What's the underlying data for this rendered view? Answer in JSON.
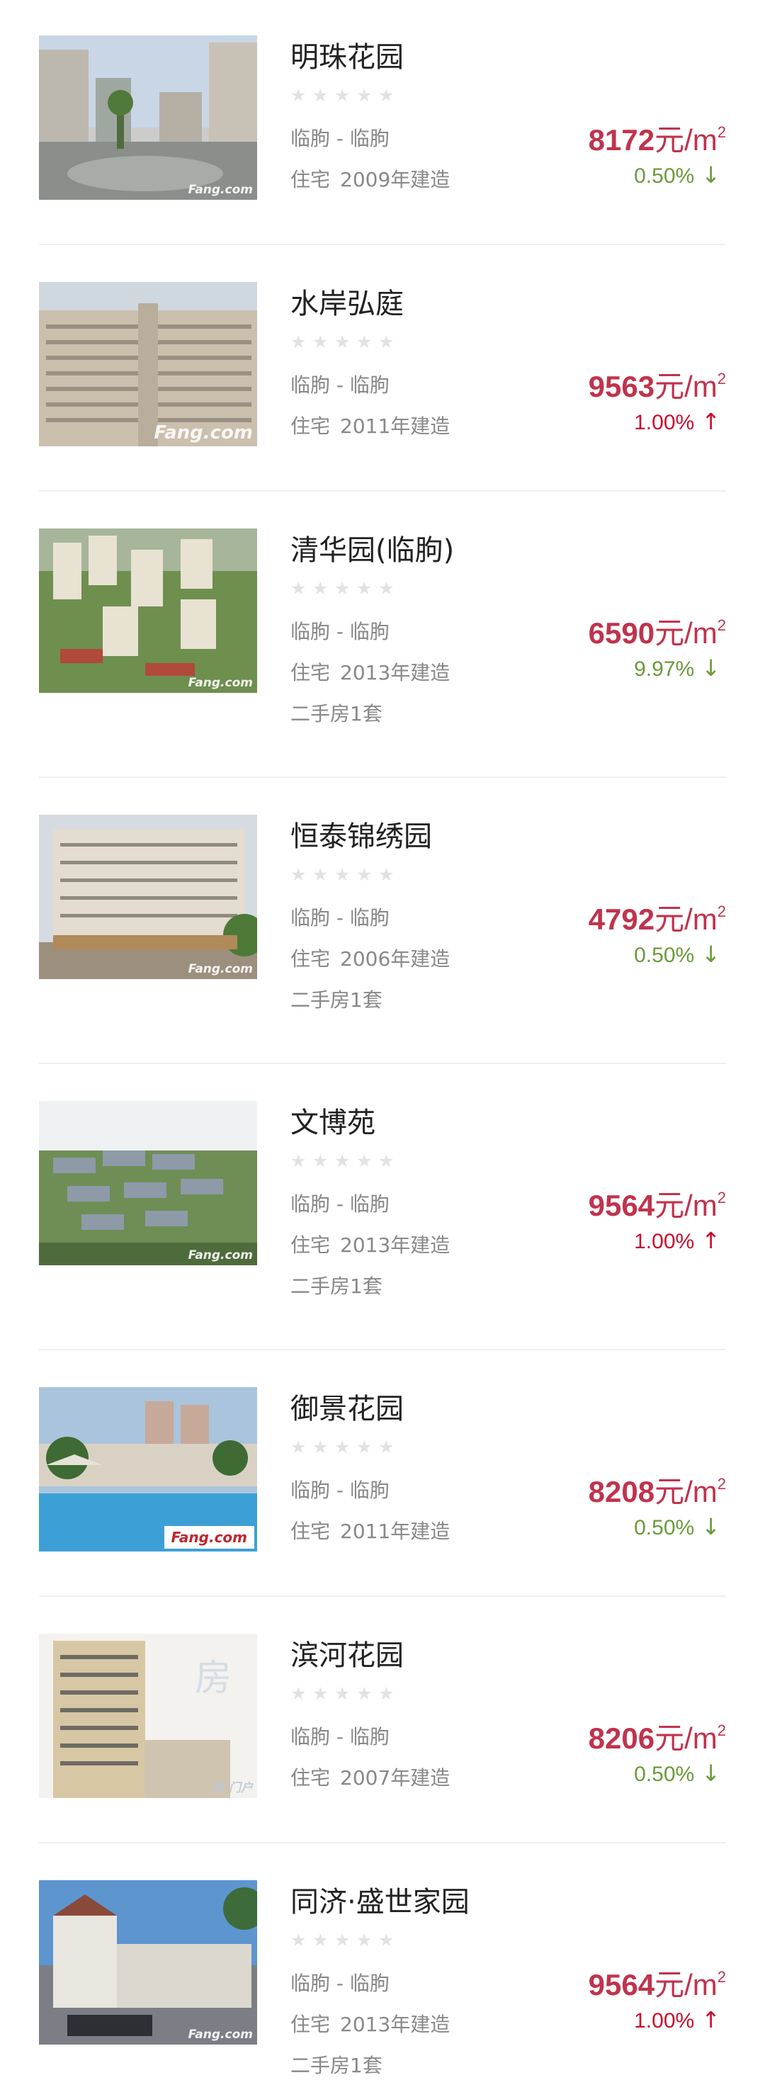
{
  "listings": [
    {
      "name": "明珠花园",
      "district": "临朐 - 临朐",
      "type": "住宅",
      "built": "2009年建造",
      "second_hand": "",
      "price_num": "8172",
      "price_unit": "元/m",
      "price_sup": "2",
      "change": "0.50%",
      "trend": "down",
      "watermark": "Fang.com",
      "image": "building-courtyard"
    },
    {
      "name": "水岸弘庭",
      "district": "临朐 - 临朐",
      "type": "住宅",
      "built": "2011年建造",
      "second_hand": "",
      "price_num": "9563",
      "price_unit": "元/m",
      "price_sup": "2",
      "change": "1.00%",
      "trend": "up",
      "watermark": "Fang.com",
      "image": "tower-facade"
    },
    {
      "name": "清华园(临朐)",
      "district": "临朐 - 临朐",
      "type": "住宅",
      "built": "2013年建造",
      "second_hand": "二手房1套",
      "price_num": "6590",
      "price_unit": "元/m",
      "price_sup": "2",
      "change": "9.97%",
      "trend": "down",
      "watermark": "Fang.com",
      "image": "aerial-render"
    },
    {
      "name": "恒泰锦绣园",
      "district": "临朐 - 临朐",
      "type": "住宅",
      "built": "2006年建造",
      "second_hand": "二手房1套",
      "price_num": "4792",
      "price_unit": "元/m",
      "price_sup": "2",
      "change": "0.50%",
      "trend": "down",
      "watermark": "Fang.com",
      "image": "street-building"
    },
    {
      "name": "文博苑",
      "district": "临朐 - 临朐",
      "type": "住宅",
      "built": "2013年建造",
      "second_hand": "二手房1套",
      "price_num": "9564",
      "price_unit": "元/m",
      "price_sup": "2",
      "change": "1.00%",
      "trend": "up",
      "watermark": "Fang.com",
      "image": "aerial-rows"
    },
    {
      "name": "御景花园",
      "district": "临朐 - 临朐",
      "type": "住宅",
      "built": "2011年建造",
      "second_hand": "",
      "price_num": "8208",
      "price_unit": "元/m",
      "price_sup": "2",
      "change": "0.50%",
      "trend": "down",
      "watermark": "Fang.com",
      "image": "pool-view"
    },
    {
      "name": "滨河花园",
      "district": "临朐 - 临朐",
      "type": "住宅",
      "built": "2007年建造",
      "second_hand": "",
      "price_num": "8206",
      "price_unit": "元/m",
      "price_sup": "2",
      "change": "0.50%",
      "trend": "down",
      "watermark": "房 门户",
      "image": "beige-tower"
    },
    {
      "name": "同济·盛世家园",
      "district": "临朐 - 临朐",
      "type": "住宅",
      "built": "2013年建造",
      "second_hand": "二手房1套",
      "price_num": "9564",
      "price_unit": "元/m",
      "price_sup": "2",
      "change": "1.00%",
      "trend": "up",
      "watermark": "Fang.com",
      "image": "clubhouse-render"
    }
  ],
  "colors": {
    "price": "#c0334d",
    "up": "#c8102e",
    "down": "#6b9a3a",
    "muted": "#888888"
  },
  "icons": {
    "star": "star-icon",
    "up": "arrow-up-icon",
    "down": "arrow-down-icon"
  }
}
